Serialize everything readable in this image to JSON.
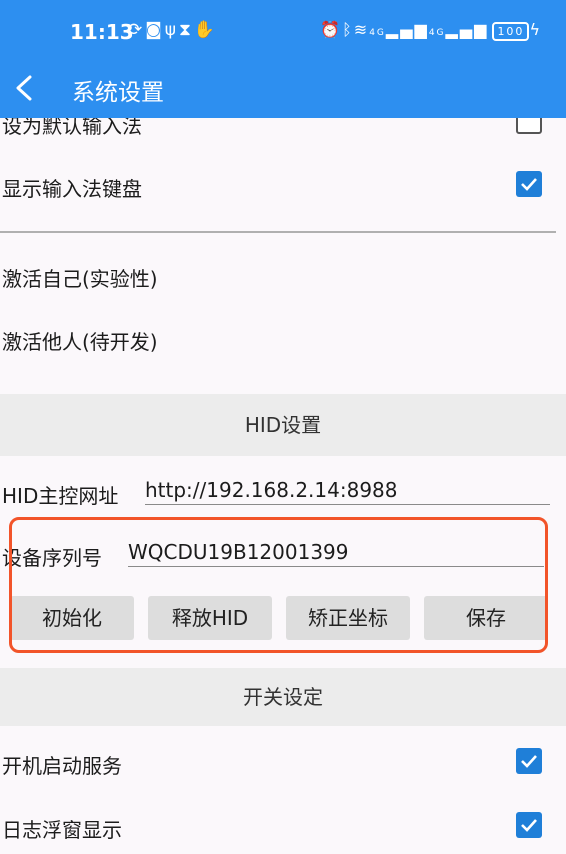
{
  "status_bar": {
    "time": "11:13",
    "left_icons": [
      "sync-icon",
      "app-notification-icon",
      "usb-icon",
      "hourglass-icon",
      "hand-icon"
    ],
    "right_icons": [
      "alarm-icon",
      "bluetooth-icon",
      "wifi-icon",
      "signal-4g-icon",
      "signal-4g-2-icon"
    ],
    "network_label_1": "4G",
    "network_label_2": "4G",
    "battery": "100",
    "charging_icon": "bolt-icon"
  },
  "app_bar": {
    "title": "系统设置",
    "back_icon": "back-arrow-icon"
  },
  "settings": {
    "default_ime": {
      "label": "设为默认输入法",
      "checked": false
    },
    "show_keyboard": {
      "label": "显示输入法键盘",
      "checked": true
    },
    "activate_self": "激活自己(实验性)",
    "activate_other": "激活他人(待开发)"
  },
  "hid_section": {
    "header": "HID设置",
    "host_label": "HID主控网址",
    "host_value": "http://192.168.2.14:8988",
    "serial_label": "设备序列号",
    "serial_value": "WQCDU19B12001399",
    "buttons": [
      "初始化",
      "释放HID",
      "矫正坐标",
      "保存"
    ]
  },
  "switch_section": {
    "header": "开关设定",
    "start_service": {
      "label": "开机启动服务",
      "checked": true
    },
    "log_float": {
      "label": "日志浮窗显示",
      "checked": true
    }
  },
  "colors": {
    "primary": "#2d8ff0",
    "checkbox": "#1f7fd8",
    "highlight": "#f2542a"
  }
}
